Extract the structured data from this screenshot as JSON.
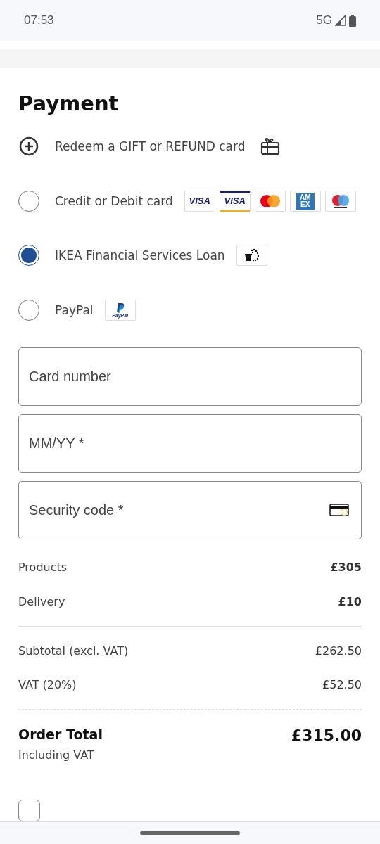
{
  "status_bar": {
    "time": "07:53",
    "network": "5G"
  },
  "title": "Payment",
  "gift": {
    "label": "Redeem a GIFT or REFUND card"
  },
  "methods": [
    {
      "label": "Credit or Debit card",
      "selected": false,
      "logos": [
        {
          "kind": "visa",
          "label": "VISA"
        },
        {
          "kind": "visa-electron",
          "label": "VISA"
        },
        {
          "kind": "mastercard"
        },
        {
          "kind": "amex",
          "lines": [
            "AM",
            "EX"
          ]
        },
        {
          "kind": "maestro"
        }
      ]
    },
    {
      "label": "IKEA Financial Services Loan",
      "selected": true,
      "logos": [
        {
          "kind": "loan"
        }
      ]
    },
    {
      "label": "PayPal",
      "selected": false,
      "logos": [
        {
          "kind": "paypal",
          "label": "PayPal"
        }
      ]
    }
  ],
  "fields": [
    {
      "placeholder": "Card number"
    },
    {
      "placeholder": "MM/YY *"
    },
    {
      "placeholder": "Security code *",
      "kind": "cvc"
    }
  ],
  "summary": [
    {
      "label": "Products",
      "value": "£305",
      "kind": "bold"
    },
    {
      "label": "Delivery",
      "value": "£10",
      "kind": "bold"
    },
    {
      "label": "Subtotal (excl. VAT)",
      "value": "£262.50",
      "kind": "plain"
    },
    {
      "label": "VAT (20%)",
      "value": "£52.50",
      "kind": "plain"
    }
  ],
  "total": {
    "label": "Order Total",
    "value": "£315.00",
    "note": "Including VAT"
  },
  "terms": {
    "checked": false
  }
}
